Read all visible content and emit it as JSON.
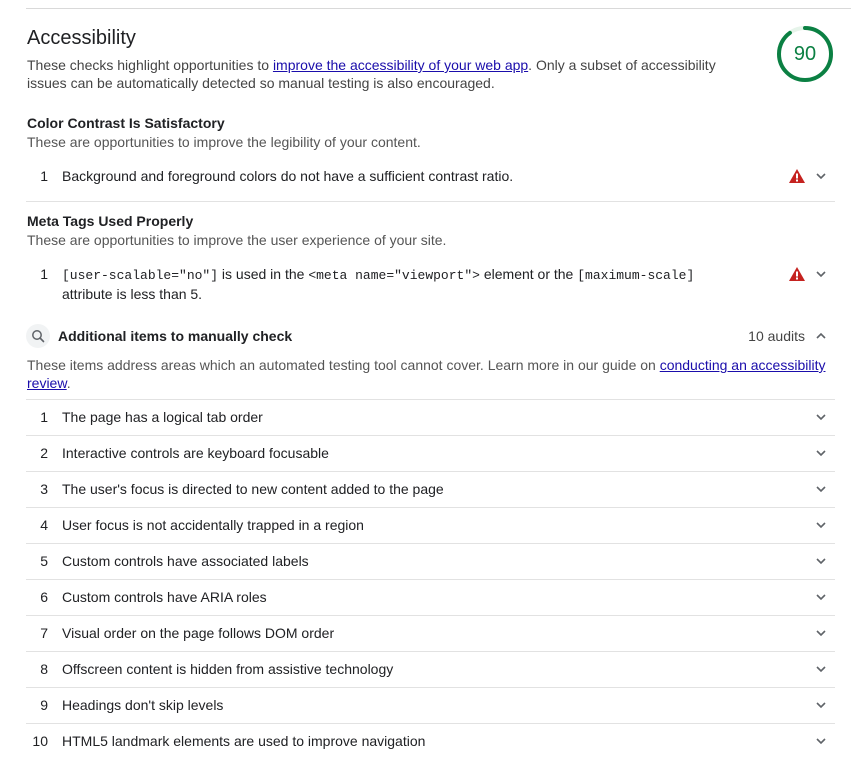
{
  "category": {
    "title": "Accessibility",
    "description_before_link": "These checks highlight opportunities to ",
    "description_link": "improve the accessibility of your web app",
    "description_after_link": ". Only a subset of accessibility issues can be automatically detected so manual testing is also encouraged.",
    "score": "90",
    "score_fraction": 0.9,
    "score_color": "#0b8043"
  },
  "groups": [
    {
      "title": "Color Contrast Is Satisfactory",
      "description": "These are opportunities to improve the legibility of your content.",
      "audits": [
        {
          "number": "1",
          "text": "Background and foreground colors do not have a sufficient contrast ratio.",
          "status_icon": "warning-triangle-icon"
        }
      ]
    },
    {
      "title": "Meta Tags Used Properly",
      "description": "These are opportunities to improve the user experience of your site.",
      "audits": [
        {
          "number": "1",
          "code1": "[user-scalable=\"no\"]",
          "text1": " is used in the ",
          "code2": "<meta name=\"viewport\">",
          "text2": " element or the ",
          "code3": "[maximum-scale]",
          "text3": " attribute is less than 5.",
          "status_icon": "warning-triangle-icon"
        }
      ]
    }
  ],
  "manual": {
    "title": "Additional items to manually check",
    "count": "10 audits",
    "description_before_link": "These items address areas which an automated testing tool cannot cover. Learn more in our guide on ",
    "description_link": "conducting an accessibility review",
    "description_after_link": ".",
    "items": [
      {
        "number": "1",
        "text": "The page has a logical tab order"
      },
      {
        "number": "2",
        "text": "Interactive controls are keyboard focusable"
      },
      {
        "number": "3",
        "text": "The user's focus is directed to new content added to the page"
      },
      {
        "number": "4",
        "text": "User focus is not accidentally trapped in a region"
      },
      {
        "number": "5",
        "text": "Custom controls have associated labels"
      },
      {
        "number": "6",
        "text": "Custom controls have ARIA roles"
      },
      {
        "number": "7",
        "text": "Visual order on the page follows DOM order"
      },
      {
        "number": "8",
        "text": "Offscreen content is hidden from assistive technology"
      },
      {
        "number": "9",
        "text": "Headings don't skip levels"
      },
      {
        "number": "10",
        "text": "HTML5 landmark elements are used to improve navigation"
      }
    ]
  },
  "colors": {
    "pass": "#0b8043",
    "fail": "#c5221f",
    "link": "#1a0dab"
  }
}
